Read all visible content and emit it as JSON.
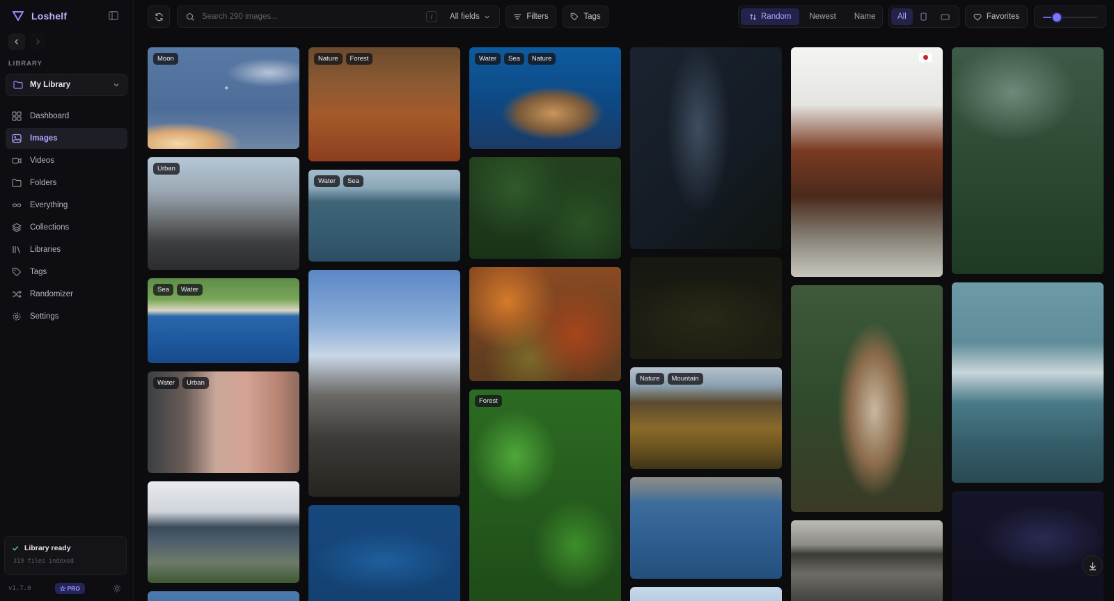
{
  "app": {
    "name": "Loshelf"
  },
  "sidebar": {
    "section_label": "LIBRARY",
    "library_name": "My Library",
    "items": [
      {
        "label": "Dashboard",
        "icon": "dashboard-icon"
      },
      {
        "label": "Images",
        "icon": "image-icon",
        "active": true
      },
      {
        "label": "Videos",
        "icon": "video-icon"
      },
      {
        "label": "Folders",
        "icon": "folder-icon"
      },
      {
        "label": "Everything",
        "icon": "infinity-icon"
      },
      {
        "label": "Collections",
        "icon": "layers-icon"
      },
      {
        "label": "Libraries",
        "icon": "library-icon"
      },
      {
        "label": "Tags",
        "icon": "tag-icon"
      },
      {
        "label": "Randomizer",
        "icon": "shuffle-icon"
      },
      {
        "label": "Settings",
        "icon": "gear-icon"
      }
    ],
    "status_title": "Library ready",
    "status_sub": "319 files indexed",
    "version": "v1.7.0",
    "pro_label": "PRO"
  },
  "toolbar": {
    "search_placeholder": "Search 290 images...",
    "shortcut": "/",
    "field_select": "All fields",
    "filters_label": "Filters",
    "tags_label": "Tags",
    "sort_options": [
      "Random",
      "Newest",
      "Name"
    ],
    "sort_active": "Random",
    "view_all_label": "All",
    "favorites_label": "Favorites",
    "size_slider": 0.25
  },
  "colors": {
    "accent": "#7b76ff",
    "accent_text": "#aaa6ff",
    "background": "#0c0c0f"
  },
  "gallery": {
    "tiles": [
      {
        "tags": [
          "Moon"
        ],
        "scene": "moon-sky"
      },
      {
        "tags": [
          "Urban"
        ],
        "scene": "city-street"
      },
      {
        "tags": [
          "Sea",
          "Water"
        ],
        "scene": "whale-coast"
      },
      {
        "tags": [
          "Water",
          "Urban"
        ],
        "scene": "venice-canal"
      },
      {
        "tags": [],
        "scene": "city-skyline"
      },
      {
        "tags": [
          "Nature",
          "Forest"
        ],
        "scene": "autumn-forest"
      },
      {
        "tags": [
          "Water",
          "Sea"
        ],
        "scene": "whale-tail"
      },
      {
        "tags": [],
        "scene": "temple-roof"
      },
      {
        "tags": [],
        "scene": "deep-water"
      },
      {
        "tags": [
          "Water",
          "Sea",
          "Nature"
        ],
        "scene": "coral-reef"
      },
      {
        "tags": [],
        "scene": "green-forest"
      },
      {
        "tags": [],
        "scene": "autumn-canopy"
      },
      {
        "tags": [
          "Forest"
        ],
        "scene": "ferns"
      },
      {
        "tags": [],
        "scene": "milky-way"
      },
      {
        "tags": [],
        "scene": "night-sky"
      },
      {
        "tags": [
          "Nature",
          "Mountain"
        ],
        "scene": "mountains"
      },
      {
        "tags": [],
        "scene": "whale-surface"
      },
      {
        "tags": [],
        "scene": "sky-strip"
      },
      {
        "tags": [],
        "scene": "pagoda",
        "flag": "japan"
      },
      {
        "tags": [],
        "scene": "hawk"
      },
      {
        "tags": [],
        "scene": "dead-trees"
      },
      {
        "tags": [],
        "scene": "misty-forest"
      },
      {
        "tags": [],
        "scene": "stormy-sea"
      },
      {
        "tags": [],
        "scene": "starfield"
      }
    ]
  }
}
